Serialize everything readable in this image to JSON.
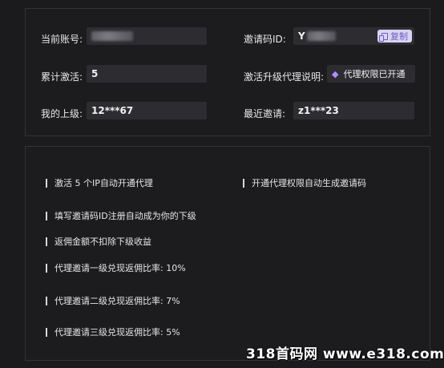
{
  "account": {
    "current_account_label": "当前账号:",
    "invite_code_label": "邀请码ID:",
    "invite_code_prefix": "Y",
    "copy_label": "复制",
    "total_activations_label": "累计激活:",
    "total_activations_value": "5",
    "upgrade_note_label": "激活升级代理说明:",
    "agent_status": "代理权限已开通",
    "my_superior_label": "我的上级:",
    "my_superior_value": "12***67",
    "recent_invite_label": "最近邀请:",
    "recent_invite_value": "z1***23"
  },
  "rules": [
    "激活 5 个IP自动开通代理",
    "开通代理权限自动生成邀请码",
    "填写邀请码ID注册自动成为你的下级",
    "返佣金额不扣除下级收益",
    "代理邀请一级兑现返佣比率: 10%",
    "代理邀请二级兑现返佣比率: 7%",
    "代理邀请三级兑现返佣比率: 5%"
  ],
  "watermark": "318首码网 www.e318.com",
  "colors": {
    "accent": "#b38dff",
    "copy_bg": "#d9d4f2",
    "copy_text": "#6b5fbf"
  }
}
